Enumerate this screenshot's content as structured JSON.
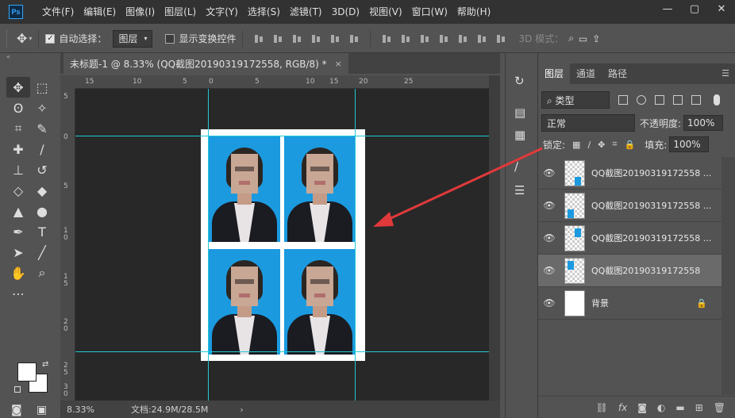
{
  "app": {
    "logo": "Ps"
  },
  "menu": [
    "文件(F)",
    "编辑(E)",
    "图像(I)",
    "图层(L)",
    "文字(Y)",
    "选择(S)",
    "滤镜(T)",
    "3D(D)",
    "视图(V)",
    "窗口(W)",
    "帮助(H)"
  ],
  "window_controls": [
    "—",
    "▢",
    "✕"
  ],
  "options": {
    "auto_select_label": "自动选择：",
    "auto_select_checked": true,
    "auto_select_target": "图层",
    "show_transform_label": "显示变换控件",
    "show_transform_checked": false,
    "mode_3d_label": "3D 模式："
  },
  "document": {
    "tab_title": "未标题-1 @ 8.33% (QQ截图20190319172558, RGB/8) *",
    "close": "×",
    "zoom": "8.33%",
    "doc_size": "文档:24.9M/28.5M",
    "status_arrow": "›"
  },
  "ruler": {
    "h_labels": [
      "15",
      "10",
      "5",
      "0",
      "5",
      "10",
      "15",
      "20",
      "25"
    ],
    "v_labels": [
      "5",
      "0",
      "5",
      "1\n0",
      "1\n5",
      "2\n0",
      "2\n5",
      "3\n0"
    ]
  },
  "layers_panel": {
    "tabs": [
      "图层",
      "通道",
      "路径"
    ],
    "filter_label": "⌕ 类型",
    "blend_mode": "正常",
    "opacity_label": "不透明度:",
    "opacity_value": "100%",
    "lock_label": "锁定:",
    "fill_label": "填充:",
    "fill_value": "100%",
    "layers": [
      {
        "name": "QQ截图20190319172558 ...",
        "selected": false
      },
      {
        "name": "QQ截图20190319172558 ...",
        "selected": false
      },
      {
        "name": "QQ截图20190319172558 ...",
        "selected": false
      },
      {
        "name": "QQ截图20190319172558",
        "selected": true
      },
      {
        "name": "背景",
        "selected": false,
        "locked": true
      }
    ],
    "footer_icons": [
      "link-icon",
      "fx-icon",
      "mask-icon",
      "adjustment-icon",
      "folder-icon",
      "new-layer-icon",
      "trash-icon"
    ]
  },
  "colors": {
    "accent_arrow": "#e0393b",
    "guide": "#21c8d6",
    "photo_background": "#1b9ae0"
  }
}
